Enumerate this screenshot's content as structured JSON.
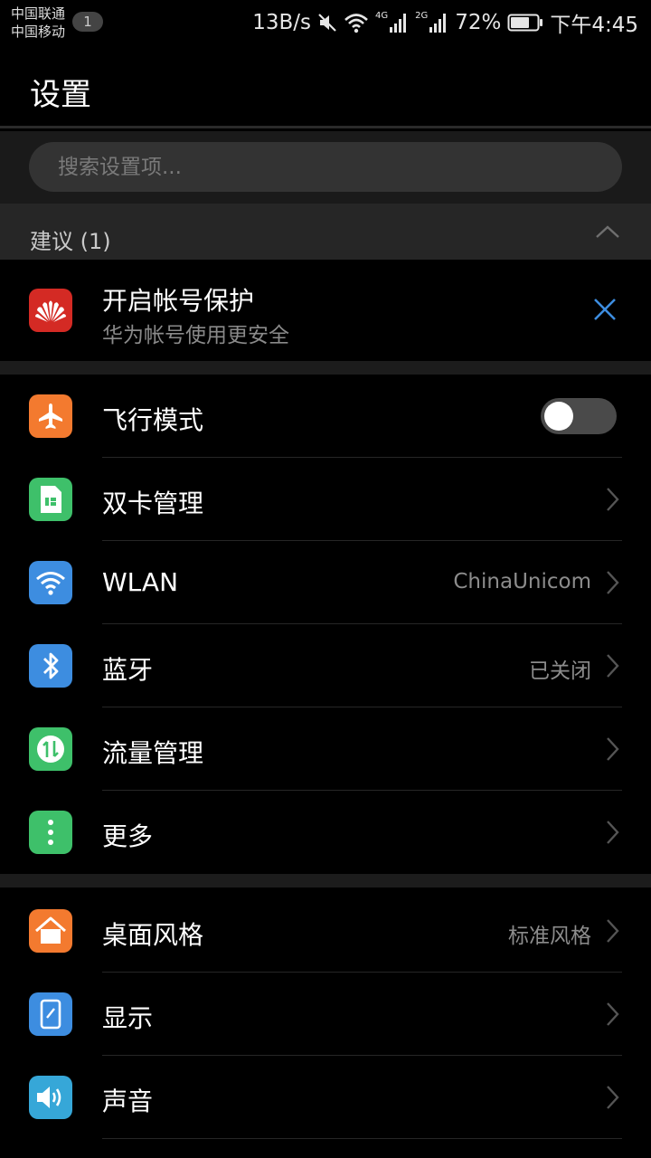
{
  "status_bar": {
    "carrier_1": "中国联通",
    "carrier_2": "中国移动",
    "notification_count": "1",
    "speed": "13B/s",
    "network_1": "4G",
    "network_2": "2G",
    "battery": "72%",
    "time": "下午4:45",
    "icons": [
      "mute-icon",
      "wifi-icon",
      "signal-icon",
      "battery-icon"
    ]
  },
  "header": {
    "title": "设置"
  },
  "search": {
    "placeholder": "搜索设置项..."
  },
  "suggestions": {
    "header": "建议 (1)",
    "card": {
      "title": "开启帐号保护",
      "subtitle": "华为帐号使用更安全"
    }
  },
  "group_1": [
    {
      "label": "飞行模式",
      "icon": "airplane-icon",
      "color": "#f37a2f",
      "toggle": "off"
    },
    {
      "label": "双卡管理",
      "icon": "sim-card-icon",
      "color": "#3ec06a"
    },
    {
      "label": "WLAN",
      "icon": "wifi-icon",
      "color": "#3d8de0",
      "value": "ChinaUnicom"
    },
    {
      "label": "蓝牙",
      "icon": "bluetooth-icon",
      "color": "#3d8de0",
      "value": "已关闭"
    },
    {
      "label": "流量管理",
      "icon": "data-usage-icon",
      "color": "#3ec06a"
    },
    {
      "label": "更多",
      "icon": "more-icon",
      "color": "#3ec06a"
    }
  ],
  "group_2": [
    {
      "label": "桌面风格",
      "icon": "home-icon",
      "color": "#f37a2f",
      "value": "标准风格"
    },
    {
      "label": "显示",
      "icon": "display-icon",
      "color": "#3d8de0"
    },
    {
      "label": "声音",
      "icon": "speaker-icon",
      "color": "#36a7d8"
    }
  ]
}
